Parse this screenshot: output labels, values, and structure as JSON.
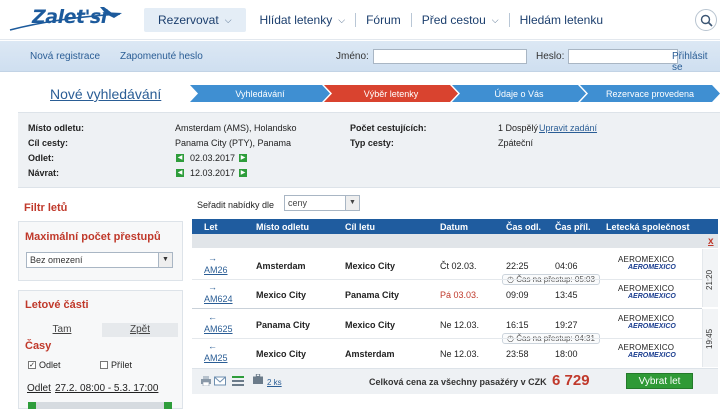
{
  "logo": {
    "text": "Zalet'si"
  },
  "nav": {
    "reserve": "Rezervovat",
    "watch": "Hlídat letenky",
    "forum": "Fórum",
    "before_trip": "Před cestou",
    "searching": "Hledám letenku"
  },
  "login": {
    "register": "Nová registrace",
    "forgot": "Zapomenuté heslo",
    "name_label": "Jméno:",
    "password_label": "Heslo:",
    "login_link": "Přihlásit se"
  },
  "new_search": "Nové vyhledávání",
  "steps": [
    {
      "label": "Vyhledávání",
      "color": "#3f8fd2"
    },
    {
      "label": "Výběr letenky",
      "color": "#d9432f"
    },
    {
      "label": "Údaje o Vás",
      "color": "#3f8fd2"
    },
    {
      "label": "Rezervace provedena",
      "color": "#3f8fd2"
    }
  ],
  "info": {
    "origin_label": "Místo odletu:",
    "origin_value": "Amsterdam (AMS), Holandsko",
    "dest_label": "Cíl cesty:",
    "dest_value": "Panama City (PTY), Panama",
    "depart_label": "Odlet:",
    "depart_value": "02.03.2017",
    "return_label": "Návrat:",
    "return_value": "12.03.2017",
    "travelers_label": "Počet cestujících:",
    "travelers_value": "1 Dospělý",
    "edit_link": "Upravit zadání",
    "trip_type_label": "Typ cesty:",
    "trip_type_value": "Zpáteční"
  },
  "sidebar": {
    "filter_title": "Filtr letů",
    "max_transfers_title": "Maximální počet přestupů",
    "max_transfers_value": "Bez omezení",
    "segments_title": "Letové části",
    "tab_there": "Tam",
    "tab_back": "Zpět",
    "times_title": "Časy",
    "cb_depart": "Odlet",
    "cb_arrive": "Přílet",
    "range_label": "Odlet",
    "range_value": "27.2. 08:00 - 5.3. 17:00"
  },
  "sort": {
    "label": "Seřadit nabídky dle",
    "value": "ceny"
  },
  "table": {
    "headers": {
      "flight": "Let",
      "origin": "Místo odletu",
      "dest": "Cíl letu",
      "date": "Datum",
      "dep": "Čas odl.",
      "arr": "Čas příl.",
      "airline": "Letecká společnost"
    },
    "close": "x",
    "rows": [
      {
        "dir": "→",
        "flight": "AM26",
        "from": "Amsterdam",
        "to": "Mexico City",
        "date": "Čt 02.03.",
        "dep": "22:25",
        "arr": "04:06",
        "airline": "AEROMEXICO",
        "airline_logo": "AEROMEXICO"
      },
      {
        "dir": "→",
        "flight": "AM624",
        "from": "Mexico City",
        "to": "Panama City",
        "date": "Pá 03.03.",
        "dep": "09:09",
        "arr": "13:45",
        "airline": "AEROMEXICO",
        "airline_logo": "AEROMEXICO"
      },
      {
        "dir": "←",
        "flight": "AM625",
        "from": "Panama City",
        "to": "Mexico City",
        "date": "Ne 12.03.",
        "dep": "16:15",
        "arr": "19:27",
        "airline": "AEROMEXICO",
        "airline_logo": "AEROMEXICO"
      },
      {
        "dir": "←",
        "flight": "AM25",
        "from": "Mexico City",
        "to": "Amsterdam",
        "date": "Ne 12.03.",
        "dep": "23:58",
        "arr": "18:00",
        "airline": "AEROMEXICO",
        "airline_logo": "AEROMEXICO"
      }
    ],
    "transfer_out": "Čas na přestup: 05:03",
    "transfer_back": "Čas na přestup: 04:31",
    "duration_out": "21:20",
    "duration_back": "19:45"
  },
  "footer": {
    "bag_count": "2 ks",
    "total_label": "Celková cena za všechny pasažéry v CZK",
    "total_value": "6 729",
    "select_button": "Vybrat let"
  }
}
